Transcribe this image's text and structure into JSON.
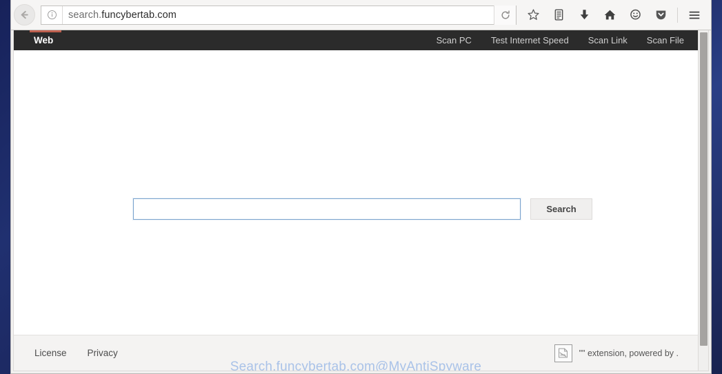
{
  "browser": {
    "url_prefix": "search.",
    "url_host": "funcybertab.com",
    "url_full": "search.funcybertab.com",
    "back_icon": "back-arrow-icon",
    "identity_icon": "info-circle-icon",
    "reload_icon": "reload-icon",
    "toolbar_icons": [
      {
        "name": "bookmark-star-icon",
        "glyph": "star"
      },
      {
        "name": "library-icon",
        "glyph": "library"
      },
      {
        "name": "downloads-icon",
        "glyph": "download-arrow"
      },
      {
        "name": "home-icon",
        "glyph": "home"
      },
      {
        "name": "sync-smiley-icon",
        "glyph": "smiley"
      },
      {
        "name": "pocket-icon",
        "glyph": "shield"
      },
      {
        "name": "menu-icon",
        "glyph": "hamburger"
      }
    ]
  },
  "site": {
    "brand": "Web",
    "accent_color": "#c0604f",
    "nav_background": "#2b2b2b",
    "nav_links": [
      {
        "label": "Scan PC"
      },
      {
        "label": "Test Internet Speed"
      },
      {
        "label": "Scan Link"
      },
      {
        "label": "Scan File"
      }
    ]
  },
  "search": {
    "value": "",
    "placeholder": "",
    "button_label": "Search",
    "focus_border_color": "#7ca4cf"
  },
  "footer": {
    "links": [
      {
        "label": "License"
      },
      {
        "label": "Privacy"
      }
    ],
    "extension_icon": "broken-image-icon",
    "extension_text": "\"\" extension, powered by ."
  },
  "watermark": {
    "text": "Search.funcybertab.com@MyAntiSpyware",
    "color": "#a9c2e8"
  }
}
